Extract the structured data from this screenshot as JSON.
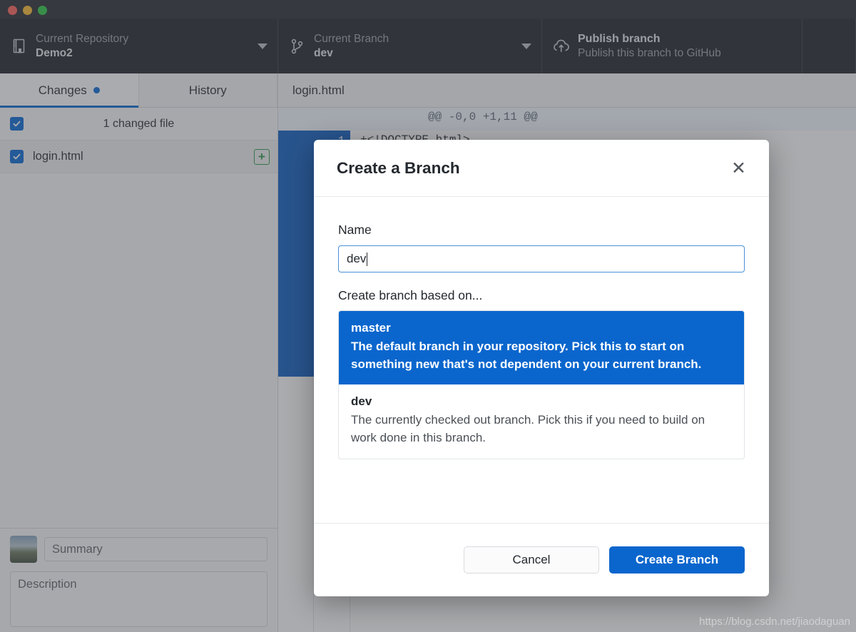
{
  "window": {
    "traffic_lights": [
      "close",
      "minimize",
      "maximize"
    ],
    "colors": {
      "close": "#ff5f57",
      "minimize": "#febc2e",
      "maximize": "#28c840",
      "accent": "#0366d6",
      "primary_button": "#0a66cd",
      "added_green": "#2a9a45",
      "toolbar_bg": "#1b1f24"
    }
  },
  "toolbar": {
    "repository": {
      "label": "Current Repository",
      "value": "Demo2",
      "icon": "repo-icon"
    },
    "branch": {
      "label": "Current Branch",
      "value": "dev",
      "icon": "branch-icon"
    },
    "publish": {
      "title": "Publish branch",
      "subtitle": "Publish this branch to GitHub",
      "icon": "cloud-upload-icon"
    }
  },
  "sidebar": {
    "tabs": [
      {
        "label": "Changes",
        "active": true,
        "has_dot": true
      },
      {
        "label": "History",
        "active": false,
        "has_dot": false
      }
    ],
    "changed_summary": "1 changed file",
    "files": [
      {
        "name": "login.html",
        "checked": true,
        "status": "+",
        "status_name": "added"
      }
    ],
    "commit": {
      "summary_placeholder": "Summary",
      "description_placeholder": "Description"
    }
  },
  "diff": {
    "filename": "login.html",
    "hunk_header": "@@ -0,0 +1,11 @@",
    "first_line": "+<!DOCTYPE html>",
    "first_line_number": "1"
  },
  "modal": {
    "title": "Create a Branch",
    "close_label": "✕",
    "name_label": "Name",
    "name_value": "dev",
    "based_on_label": "Create branch based on...",
    "branches": [
      {
        "name": "master",
        "description": "The default branch in your repository. Pick this to start on something new that's not dependent on your current branch.",
        "selected": true
      },
      {
        "name": "dev",
        "description": "The currently checked out branch. Pick this if you need to build on work done in this branch.",
        "selected": false
      }
    ],
    "cancel_label": "Cancel",
    "submit_label": "Create Branch"
  },
  "watermark": "https://blog.csdn.net/jiaodaguan"
}
